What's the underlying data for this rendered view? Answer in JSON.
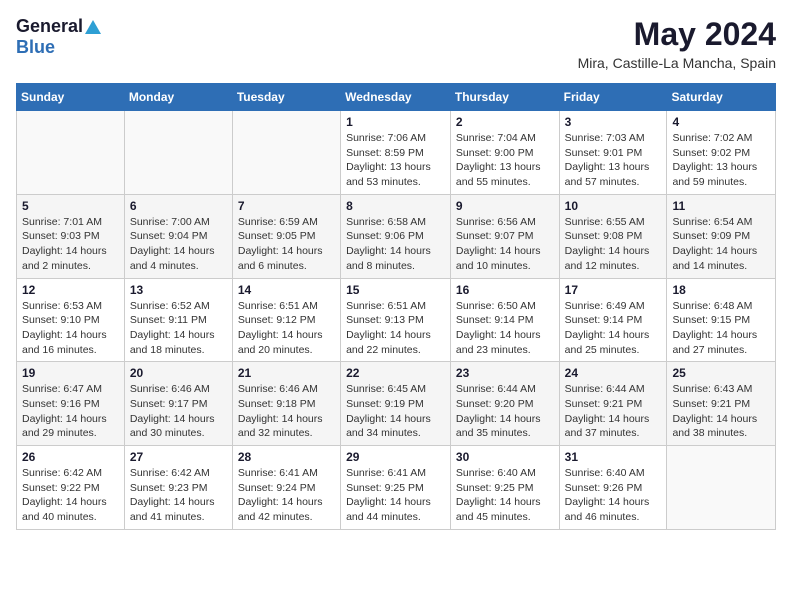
{
  "logo": {
    "general": "General",
    "blue": "Blue"
  },
  "title": {
    "month_year": "May 2024",
    "location": "Mira, Castille-La Mancha, Spain"
  },
  "headers": [
    "Sunday",
    "Monday",
    "Tuesday",
    "Wednesday",
    "Thursday",
    "Friday",
    "Saturday"
  ],
  "weeks": [
    [
      {
        "day": "",
        "info": ""
      },
      {
        "day": "",
        "info": ""
      },
      {
        "day": "",
        "info": ""
      },
      {
        "day": "1",
        "info": "Sunrise: 7:06 AM\nSunset: 8:59 PM\nDaylight: 13 hours\nand 53 minutes."
      },
      {
        "day": "2",
        "info": "Sunrise: 7:04 AM\nSunset: 9:00 PM\nDaylight: 13 hours\nand 55 minutes."
      },
      {
        "day": "3",
        "info": "Sunrise: 7:03 AM\nSunset: 9:01 PM\nDaylight: 13 hours\nand 57 minutes."
      },
      {
        "day": "4",
        "info": "Sunrise: 7:02 AM\nSunset: 9:02 PM\nDaylight: 13 hours\nand 59 minutes."
      }
    ],
    [
      {
        "day": "5",
        "info": "Sunrise: 7:01 AM\nSunset: 9:03 PM\nDaylight: 14 hours\nand 2 minutes."
      },
      {
        "day": "6",
        "info": "Sunrise: 7:00 AM\nSunset: 9:04 PM\nDaylight: 14 hours\nand 4 minutes."
      },
      {
        "day": "7",
        "info": "Sunrise: 6:59 AM\nSunset: 9:05 PM\nDaylight: 14 hours\nand 6 minutes."
      },
      {
        "day": "8",
        "info": "Sunrise: 6:58 AM\nSunset: 9:06 PM\nDaylight: 14 hours\nand 8 minutes."
      },
      {
        "day": "9",
        "info": "Sunrise: 6:56 AM\nSunset: 9:07 PM\nDaylight: 14 hours\nand 10 minutes."
      },
      {
        "day": "10",
        "info": "Sunrise: 6:55 AM\nSunset: 9:08 PM\nDaylight: 14 hours\nand 12 minutes."
      },
      {
        "day": "11",
        "info": "Sunrise: 6:54 AM\nSunset: 9:09 PM\nDaylight: 14 hours\nand 14 minutes."
      }
    ],
    [
      {
        "day": "12",
        "info": "Sunrise: 6:53 AM\nSunset: 9:10 PM\nDaylight: 14 hours\nand 16 minutes."
      },
      {
        "day": "13",
        "info": "Sunrise: 6:52 AM\nSunset: 9:11 PM\nDaylight: 14 hours\nand 18 minutes."
      },
      {
        "day": "14",
        "info": "Sunrise: 6:51 AM\nSunset: 9:12 PM\nDaylight: 14 hours\nand 20 minutes."
      },
      {
        "day": "15",
        "info": "Sunrise: 6:51 AM\nSunset: 9:13 PM\nDaylight: 14 hours\nand 22 minutes."
      },
      {
        "day": "16",
        "info": "Sunrise: 6:50 AM\nSunset: 9:14 PM\nDaylight: 14 hours\nand 23 minutes."
      },
      {
        "day": "17",
        "info": "Sunrise: 6:49 AM\nSunset: 9:14 PM\nDaylight: 14 hours\nand 25 minutes."
      },
      {
        "day": "18",
        "info": "Sunrise: 6:48 AM\nSunset: 9:15 PM\nDaylight: 14 hours\nand 27 minutes."
      }
    ],
    [
      {
        "day": "19",
        "info": "Sunrise: 6:47 AM\nSunset: 9:16 PM\nDaylight: 14 hours\nand 29 minutes."
      },
      {
        "day": "20",
        "info": "Sunrise: 6:46 AM\nSunset: 9:17 PM\nDaylight: 14 hours\nand 30 minutes."
      },
      {
        "day": "21",
        "info": "Sunrise: 6:46 AM\nSunset: 9:18 PM\nDaylight: 14 hours\nand 32 minutes."
      },
      {
        "day": "22",
        "info": "Sunrise: 6:45 AM\nSunset: 9:19 PM\nDaylight: 14 hours\nand 34 minutes."
      },
      {
        "day": "23",
        "info": "Sunrise: 6:44 AM\nSunset: 9:20 PM\nDaylight: 14 hours\nand 35 minutes."
      },
      {
        "day": "24",
        "info": "Sunrise: 6:44 AM\nSunset: 9:21 PM\nDaylight: 14 hours\nand 37 minutes."
      },
      {
        "day": "25",
        "info": "Sunrise: 6:43 AM\nSunset: 9:21 PM\nDaylight: 14 hours\nand 38 minutes."
      }
    ],
    [
      {
        "day": "26",
        "info": "Sunrise: 6:42 AM\nSunset: 9:22 PM\nDaylight: 14 hours\nand 40 minutes."
      },
      {
        "day": "27",
        "info": "Sunrise: 6:42 AM\nSunset: 9:23 PM\nDaylight: 14 hours\nand 41 minutes."
      },
      {
        "day": "28",
        "info": "Sunrise: 6:41 AM\nSunset: 9:24 PM\nDaylight: 14 hours\nand 42 minutes."
      },
      {
        "day": "29",
        "info": "Sunrise: 6:41 AM\nSunset: 9:25 PM\nDaylight: 14 hours\nand 44 minutes."
      },
      {
        "day": "30",
        "info": "Sunrise: 6:40 AM\nSunset: 9:25 PM\nDaylight: 14 hours\nand 45 minutes."
      },
      {
        "day": "31",
        "info": "Sunrise: 6:40 AM\nSunset: 9:26 PM\nDaylight: 14 hours\nand 46 minutes."
      },
      {
        "day": "",
        "info": ""
      }
    ]
  ]
}
